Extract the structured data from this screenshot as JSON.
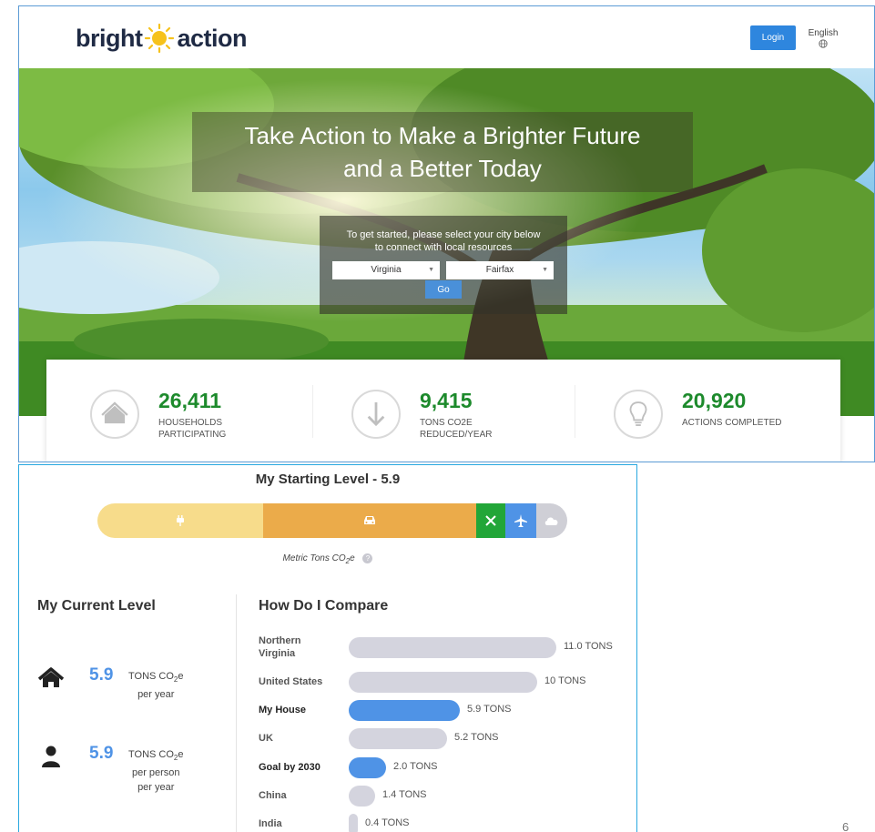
{
  "header": {
    "logo_left": "bright",
    "logo_right": "action",
    "login_label": "Login",
    "language_label": "English"
  },
  "hero": {
    "title_line1": "Take Action to Make a Brighter Future",
    "title_line2": "and a Better Today",
    "prompt_line1": "To get started, please select your city below",
    "prompt_line2": "to connect with local resources",
    "state_value": "Virginia",
    "city_value": "Fairfax",
    "go_label": "Go"
  },
  "stats": [
    {
      "icon": "house-icon",
      "value": "26,411",
      "label_line1": "HOUSEHOLDS",
      "label_line2": "PARTICIPATING"
    },
    {
      "icon": "down-arrow-icon",
      "value": "9,415",
      "label_line1": "TONS CO2E",
      "label_line2": "REDUCED/YEAR"
    },
    {
      "icon": "lightbulb-icon",
      "value": "20,920",
      "label_line1": "ACTIONS COMPLETED",
      "label_line2": ""
    }
  ],
  "starting_level": {
    "title": "My Starting Level - 5.9",
    "segments": [
      {
        "icon": "plug-icon",
        "color": "#f7dc8b"
      },
      {
        "icon": "car-icon",
        "color": "#ebab4a"
      },
      {
        "icon": "utensils-icon",
        "color": "#22a638"
      },
      {
        "icon": "plane-icon",
        "color": "#4f93e6"
      },
      {
        "icon": "cloud-icon",
        "color": "#cfcfd6"
      }
    ],
    "unit_prefix": "Metric Tons CO",
    "unit_sub": "2",
    "unit_suffix": "e",
    "help_glyph": "?"
  },
  "current_level": {
    "title": "My Current Level",
    "rows": [
      {
        "icon": "house-icon",
        "value": "5.9",
        "unit_prefix": "TONS CO",
        "unit_sub": "2",
        "unit_suffix": "e",
        "line2": "per year",
        "line3": ""
      },
      {
        "icon": "person-icon",
        "value": "5.9",
        "unit_prefix": "TONS CO",
        "unit_sub": "2",
        "unit_suffix": "e",
        "line2": "per person",
        "line3": "per year"
      }
    ]
  },
  "compare": {
    "title": "How Do I Compare",
    "rows": [
      {
        "label": "Northern Virginia",
        "value": 11.0,
        "value_label": "11.0 TONS",
        "highlight": false
      },
      {
        "label": "United States",
        "value": 10.0,
        "value_label": "10 TONS",
        "highlight": false
      },
      {
        "label": "My House",
        "value": 5.9,
        "value_label": "5.9 TONS",
        "highlight": true
      },
      {
        "label": "UK",
        "value": 5.2,
        "value_label": "5.2 TONS",
        "highlight": false
      },
      {
        "label": "Goal by 2030",
        "value": 2.0,
        "value_label": "2.0 TONS",
        "highlight": true
      },
      {
        "label": "China",
        "value": 1.4,
        "value_label": "1.4 TONS",
        "highlight": false
      },
      {
        "label": "India",
        "value": 0.4,
        "value_label": "0.4 TONS",
        "highlight": false
      }
    ],
    "max_value": 11.0
  },
  "page_number": "6",
  "colors": {
    "brand_blue": "#2e86de",
    "stat_green": "#1d8a2c",
    "highlight_blue": "#4f93e6"
  }
}
